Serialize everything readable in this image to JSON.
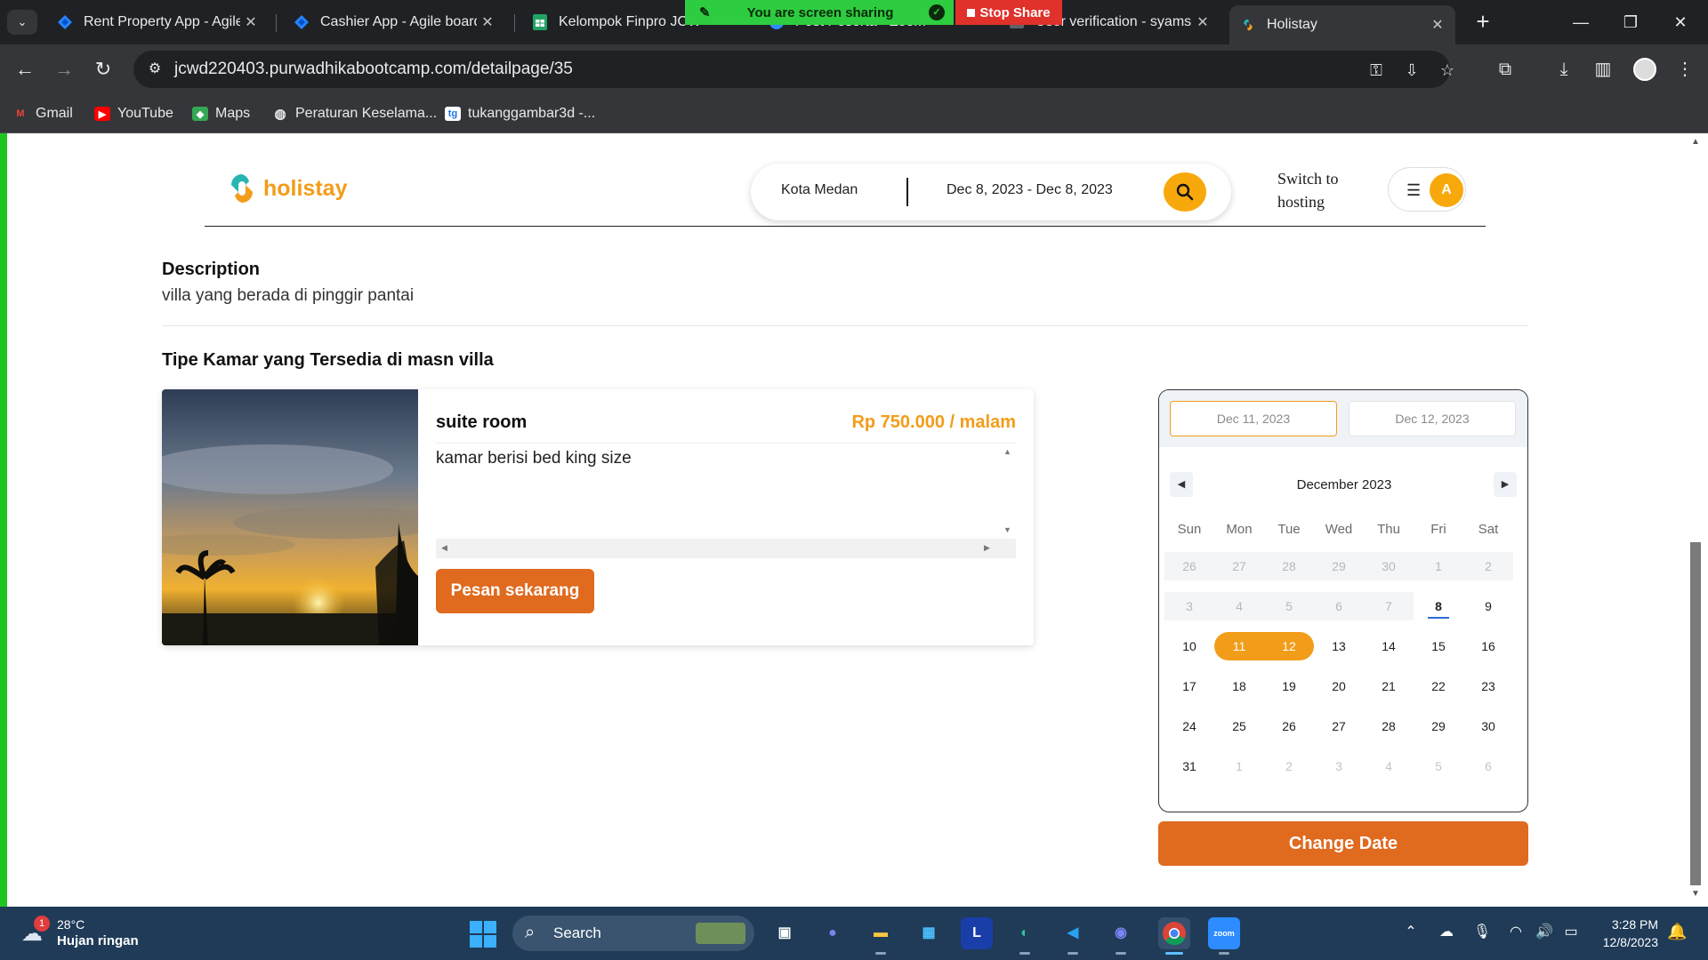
{
  "browser": {
    "tabs": [
      {
        "title": "Rent Property App - Agile b",
        "favicon": "jira-icon"
      },
      {
        "title": "Cashier App - Agile board",
        "favicon": "jira-icon"
      },
      {
        "title": "Kelompok Finpro JCWD",
        "favicon": "sheets-icon"
      },
      {
        "title": "Post Peserta - Zoom",
        "favicon": "zoom-icon"
      },
      {
        "title": "User verification - syamsud",
        "favicon": "mail-icon"
      },
      {
        "title": "Holistay",
        "favicon": "holistay-icon"
      }
    ],
    "screen_share": {
      "message": "You are screen sharing",
      "stop_label": "Stop Share"
    },
    "url": "jcwd220403.purwadhikabootcamp.com/detailpage/35",
    "bookmarks": [
      {
        "label": "Gmail",
        "icon": "gmail-icon"
      },
      {
        "label": "YouTube",
        "icon": "youtube-icon"
      },
      {
        "label": "Maps",
        "icon": "maps-icon"
      },
      {
        "label": "Peraturan Keselama...",
        "icon": "globe-icon"
      },
      {
        "label": "tukanggambar3d -...",
        "icon": "tg-icon"
      }
    ]
  },
  "site": {
    "logo_text": "holistay",
    "search": {
      "location": "Kota Medan",
      "dates": "Dec 8, 2023 - Dec 8, 2023"
    },
    "switch_hosting": "Switch to hosting",
    "avatar_initial": "A"
  },
  "description": {
    "title": "Description",
    "text": "villa yang berada di pinggir pantai"
  },
  "rooms_section": {
    "title": "Tipe Kamar yang Tersedia di masn villa",
    "room": {
      "name": "suite room",
      "price": "Rp 750.000 / malam",
      "description": "kamar berisi bed king size",
      "button": "Pesan sekarang"
    }
  },
  "datepicker": {
    "start": "Dec 11, 2023",
    "end": "Dec 12, 2023",
    "month": "December 2023",
    "weekdays": [
      "Sun",
      "Mon",
      "Tue",
      "Wed",
      "Thu",
      "Fri",
      "Sat"
    ],
    "weeks": [
      [
        "26",
        "27",
        "28",
        "29",
        "30",
        "1",
        "2"
      ],
      [
        "3",
        "4",
        "5",
        "6",
        "7",
        "8",
        "9"
      ],
      [
        "10",
        "11",
        "12",
        "13",
        "14",
        "15",
        "16"
      ],
      [
        "17",
        "18",
        "19",
        "20",
        "21",
        "22",
        "23"
      ],
      [
        "24",
        "25",
        "26",
        "27",
        "28",
        "29",
        "30"
      ],
      [
        "31",
        "1",
        "2",
        "3",
        "4",
        "5",
        "6"
      ]
    ],
    "button": "Change Date"
  },
  "taskbar": {
    "weather": {
      "temp": "28°C",
      "condition": "Hujan ringan",
      "badge": "1"
    },
    "search_label": "Search",
    "apps": [
      "task-view-icon",
      "teams-chat-icon",
      "file-explorer-icon",
      "store-icon",
      "l-app-icon",
      "edge-icon",
      "vscode-icon",
      "discord-icon",
      "chrome-icon",
      "zoom-icon"
    ],
    "time": "3:28 PM",
    "date": "12/8/2023"
  }
}
